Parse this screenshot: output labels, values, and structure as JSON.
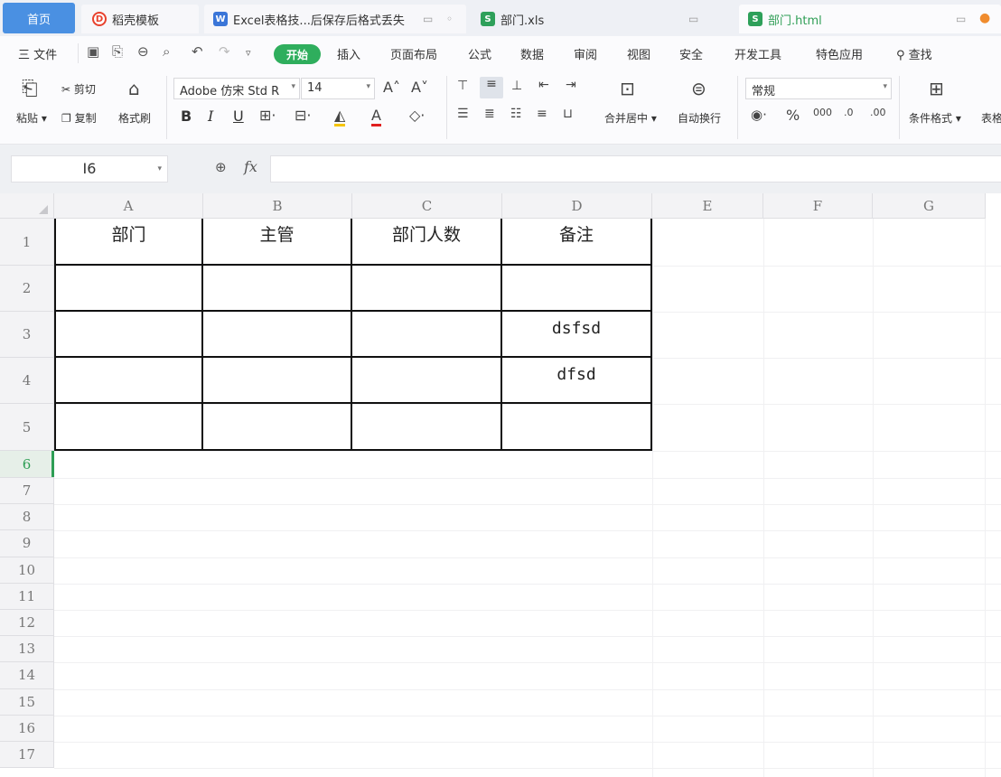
{
  "tabs": [
    {
      "label": "首页"
    },
    {
      "label": "稻壳模板"
    },
    {
      "label": "Excel表格技...后保存后格式丢失"
    },
    {
      "label": "部门.xls"
    },
    {
      "label": "部门.html"
    }
  ],
  "menu": {
    "file": "三 文件",
    "items": [
      "开始",
      "插入",
      "页面布局",
      "公式",
      "数据",
      "审阅",
      "视图",
      "安全",
      "开发工具",
      "特色应用"
    ],
    "search": "查找"
  },
  "ribbon": {
    "paste": "粘贴",
    "cut": "剪切",
    "copy": "复制",
    "format_painter": "格式刷",
    "font_name": "Adobe 仿宋 Std R",
    "font_size": "14",
    "bold": "B",
    "italic": "I",
    "underline": "U",
    "merge_center": "合并居中",
    "wrap_text": "自动换行",
    "number_format": "常规",
    "conditional_format": "条件格式",
    "table_style": "表格"
  },
  "formula_bar": {
    "cell_ref": "I6",
    "fx_label": "fx",
    "formula": ""
  },
  "sheet": {
    "columns": [
      "A",
      "B",
      "C",
      "D",
      "E",
      "F",
      "G"
    ],
    "rows": [
      "1",
      "2",
      "3",
      "4",
      "5",
      "6",
      "7",
      "8",
      "9",
      "10",
      "11",
      "12",
      "13",
      "14",
      "15",
      "16",
      "17"
    ],
    "active_row": "6",
    "cells": [
      [
        "部门",
        "主管",
        "部门人数",
        "备注"
      ],
      [
        "",
        "",
        "",
        ""
      ],
      [
        "",
        "",
        "",
        "dsfsd"
      ],
      [
        "",
        "",
        "",
        "dfsd"
      ],
      [
        "",
        "",
        "",
        ""
      ]
    ]
  },
  "colors": {
    "accent_green": "#2fae5d",
    "home_tab_blue": "#4a90e2"
  }
}
